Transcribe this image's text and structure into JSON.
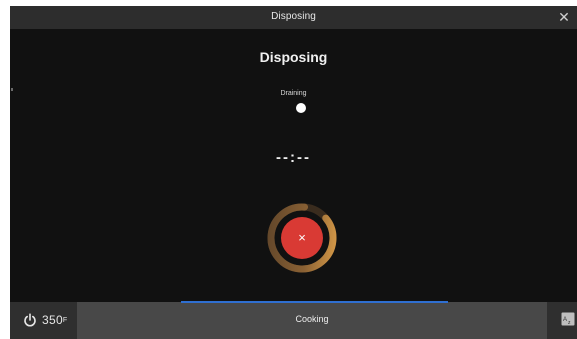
{
  "window": {
    "title": "Disposing",
    "close_icon": "close-icon"
  },
  "main": {
    "heading": "Disposing",
    "step_label": "Draining",
    "timer": "--:--",
    "cancel_symbol": "×"
  },
  "bottom": {
    "power_temp": "350",
    "power_unit": "F",
    "mode_label": "Cooking",
    "lang_icon": "language-icon"
  },
  "colors": {
    "background": "#111111",
    "titlebar": "#2d2d2d",
    "cancel": "#d93a34",
    "ring_accent": "#e3a24a",
    "progress": "#2f6fd1"
  }
}
